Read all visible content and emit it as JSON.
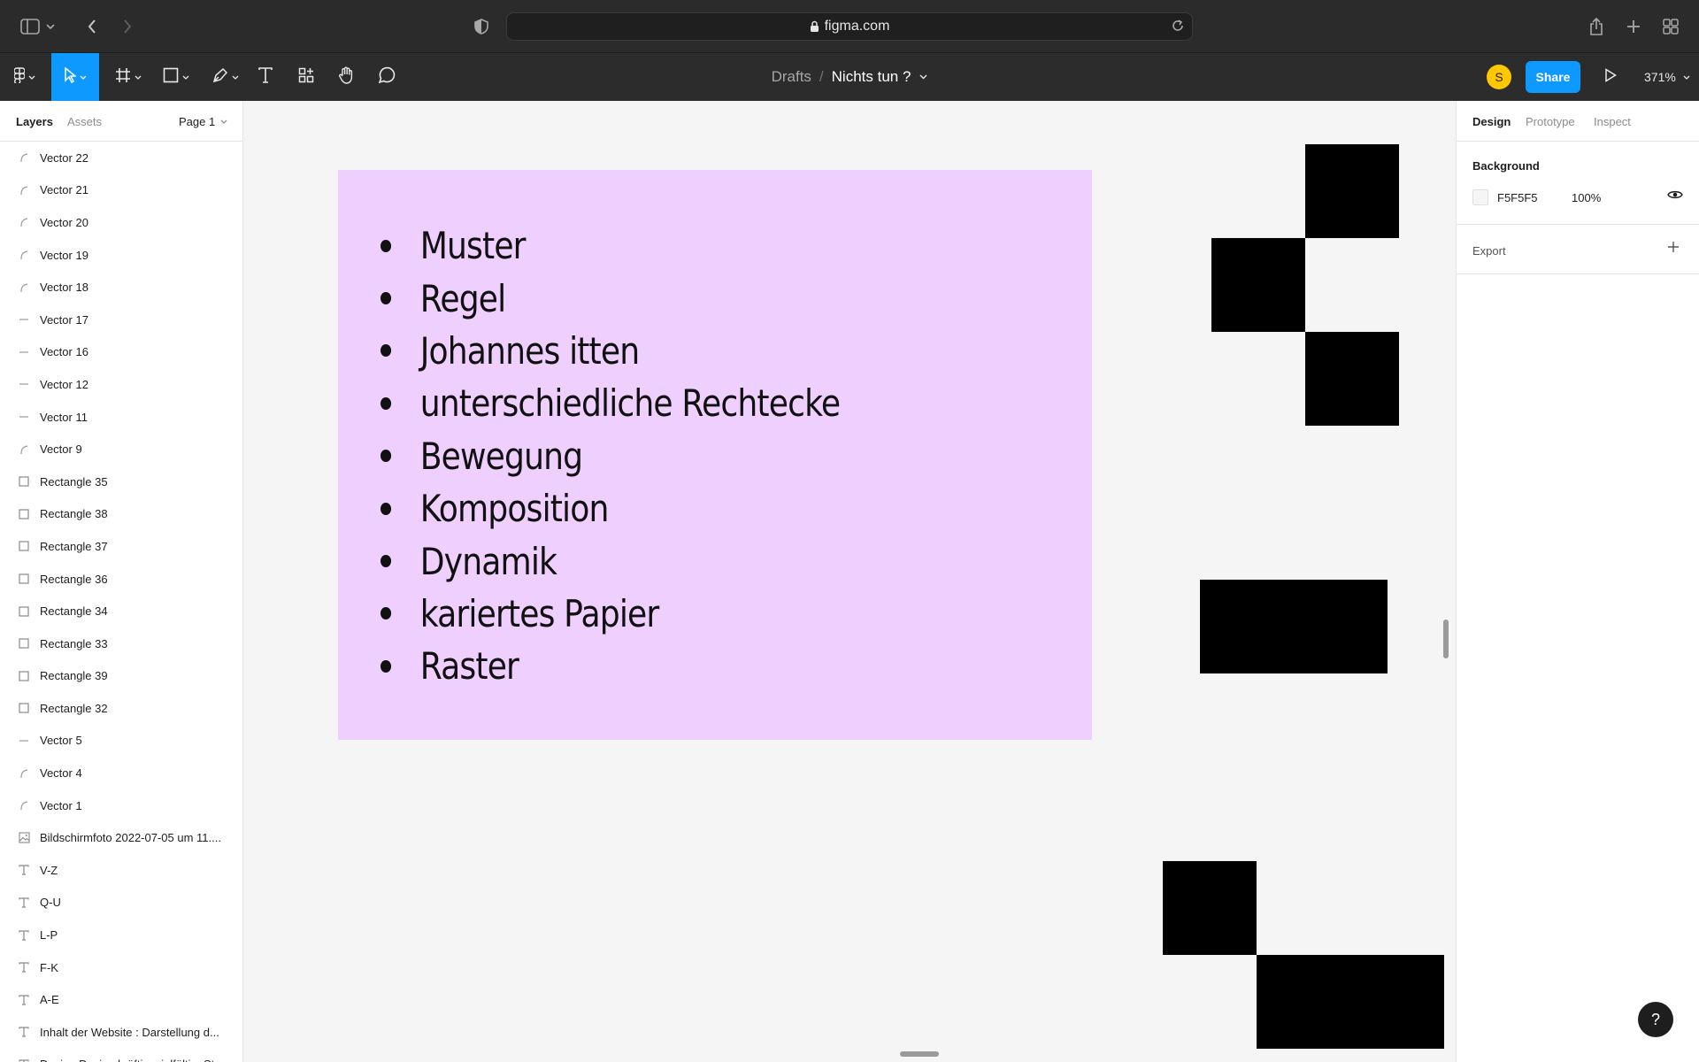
{
  "browser": {
    "url": "figma.com"
  },
  "toolbar": {
    "breadcrumb_root": "Drafts",
    "breadcrumb_sep": "/",
    "file_name": "Nichts tun ?",
    "avatar_initial": "S",
    "share_label": "Share",
    "zoom": "371%"
  },
  "left_panel": {
    "tabs": [
      "Layers",
      "Assets"
    ],
    "page": "Page 1",
    "layers": [
      {
        "name": "Vector 22",
        "icon": "vector-icon"
      },
      {
        "name": "Vector 21",
        "icon": "vector-icon"
      },
      {
        "name": "Vector 20",
        "icon": "vector-icon"
      },
      {
        "name": "Vector 19",
        "icon": "vector-icon"
      },
      {
        "name": "Vector 18",
        "icon": "vector-icon"
      },
      {
        "name": "Vector 17",
        "icon": "line-icon"
      },
      {
        "name": "Vector 16",
        "icon": "line-icon"
      },
      {
        "name": "Vector 12",
        "icon": "line-icon"
      },
      {
        "name": "Vector 11",
        "icon": "line-icon"
      },
      {
        "name": "Vector 9",
        "icon": "vector-icon"
      },
      {
        "name": "Rectangle 35",
        "icon": "rectangle-icon"
      },
      {
        "name": "Rectangle 38",
        "icon": "rectangle-icon"
      },
      {
        "name": "Rectangle 37",
        "icon": "rectangle-icon"
      },
      {
        "name": "Rectangle 36",
        "icon": "rectangle-icon"
      },
      {
        "name": "Rectangle 34",
        "icon": "rectangle-icon"
      },
      {
        "name": "Rectangle 33",
        "icon": "rectangle-icon"
      },
      {
        "name": "Rectangle 39",
        "icon": "rectangle-icon"
      },
      {
        "name": "Rectangle 32",
        "icon": "rectangle-icon"
      },
      {
        "name": "Vector 5",
        "icon": "line-icon"
      },
      {
        "name": "Vector 4",
        "icon": "vector-icon"
      },
      {
        "name": "Vector 1",
        "icon": "vector-icon"
      },
      {
        "name": "Bildschirmfoto 2022-07-05 um 11....",
        "icon": "image-icon"
      },
      {
        "name": "V-Z",
        "icon": "text-icon"
      },
      {
        "name": "Q-U",
        "icon": "text-icon"
      },
      {
        "name": "L-P",
        "icon": "text-icon"
      },
      {
        "name": "F-K",
        "icon": "text-icon"
      },
      {
        "name": "A-E",
        "icon": "text-icon"
      },
      {
        "name": "Inhalt der Website : Darstellung d...",
        "icon": "text-icon"
      },
      {
        "name": "Design Design kräftig, vielfältig, St...",
        "icon": "text-icon"
      }
    ]
  },
  "canvas": {
    "frame_color": "#EECFFD",
    "bullets": [
      "Muster",
      "Regel",
      "Johannes itten",
      "unterschiedliche Rechtecke",
      "Bewegung",
      "Komposition",
      "Dynamik",
      "kariertes Papier",
      "Raster"
    ]
  },
  "right_panel": {
    "tabs": [
      "Design",
      "Prototype",
      "Inspect"
    ],
    "background_label": "Background",
    "background_hex": "F5F5F5",
    "background_opacity": "100%",
    "export_label": "Export"
  },
  "help_label": "?",
  "colors": {
    "accent": "#0D99FF",
    "avatar": "#FFC700",
    "toolbar": "#2C2C2C",
    "canvas": "#F5F5F5"
  }
}
